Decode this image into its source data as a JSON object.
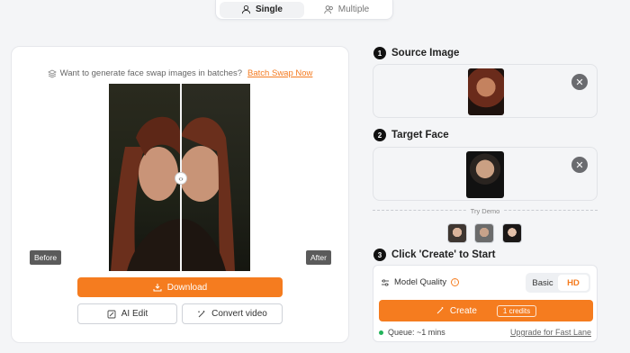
{
  "mode_switch": {
    "single": "Single",
    "multiple": "Multiple"
  },
  "left": {
    "batch_text": "Want to generate face swap images in batches?",
    "batch_link": "Batch Swap Now",
    "before": "Before",
    "after": "After",
    "download": "Download",
    "ai_edit": "AI Edit",
    "convert_video": "Convert video"
  },
  "steps": {
    "s1": {
      "num": "1",
      "title": "Source Image"
    },
    "s2": {
      "num": "2",
      "title": "Target Face"
    },
    "s3": {
      "num": "3",
      "title": "Click 'Create' to Start"
    }
  },
  "try_demo": "Try Demo",
  "create": {
    "model_quality": "Model Quality",
    "basic": "Basic",
    "hd": "HD",
    "button": "Create",
    "credits": "1 credits",
    "queue": "Queue: ~1 mins",
    "fast_lane": "Upgrade for Fast Lane"
  },
  "colors": {
    "accent": "#f57c1f",
    "queue_dot": "#22b35a"
  }
}
